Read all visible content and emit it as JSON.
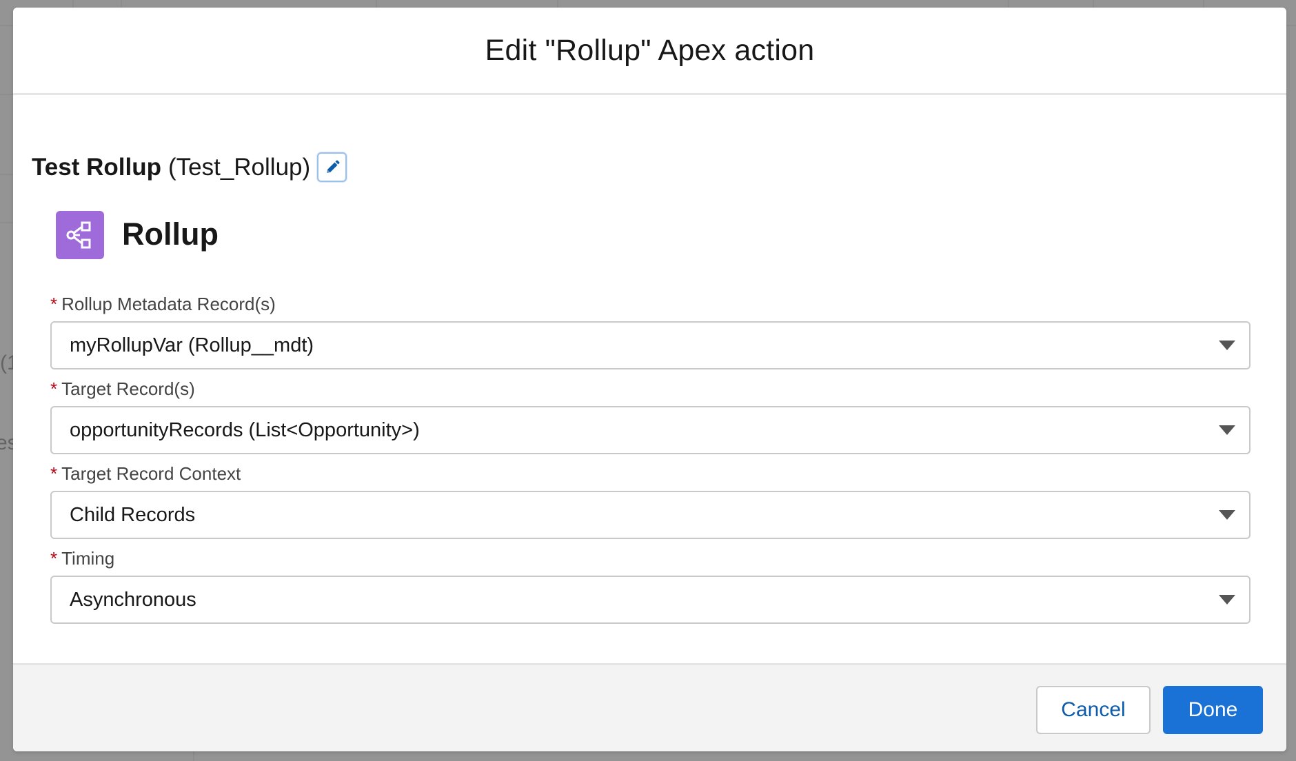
{
  "background": {
    "fragments": [
      "(1",
      "es"
    ]
  },
  "modal": {
    "title": "Edit \"Rollup\" Apex action",
    "action": {
      "label": "Test Rollup",
      "api_name": "(Test_Rollup)"
    },
    "apex_class": {
      "icon": "apex-action-icon",
      "title": "Rollup"
    },
    "fields": [
      {
        "label": "Rollup Metadata Record(s)",
        "required": true,
        "value": "myRollupVar (Rollup__mdt)"
      },
      {
        "label": "Target Record(s)",
        "required": true,
        "value": "opportunityRecords (List<Opportunity>)"
      },
      {
        "label": "Target Record Context",
        "required": true,
        "value": "Child Records"
      },
      {
        "label": "Timing",
        "required": true,
        "value": "Asynchronous"
      }
    ],
    "required_marker": "*",
    "footer": {
      "cancel_label": "Cancel",
      "done_label": "Done"
    }
  },
  "colors": {
    "brand": "#1b72d6",
    "link": "#0b5cab",
    "required": "#ba0517",
    "icon_bg": "#9f6ad9"
  }
}
